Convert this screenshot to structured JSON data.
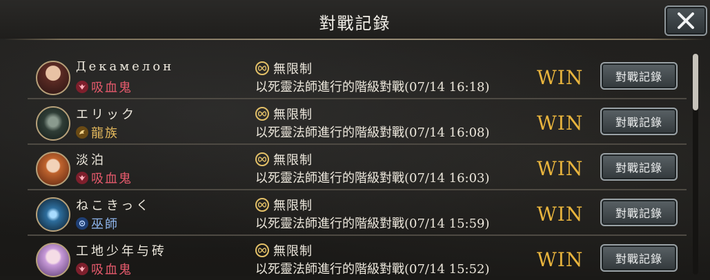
{
  "header": {
    "title": "對戰記錄"
  },
  "colors": {
    "vampire": "#e65a6c",
    "dragon": "#e3b85c",
    "mage": "#8fb6ee",
    "win": "#e8b43d"
  },
  "rows": [
    {
      "name": "Декамелон",
      "class_label": "吸血鬼",
      "class_icon": "vampire-icon",
      "mode": "無限制",
      "desc": "以死靈法師進行的階級對戰(07/14 16:18)",
      "result": "WIN",
      "button": "對戰記錄"
    },
    {
      "name": "エリック",
      "class_label": "龍族",
      "class_icon": "dragon-icon",
      "mode": "無限制",
      "desc": "以死靈法師進行的階級對戰(07/14 16:08)",
      "result": "WIN",
      "button": "對戰記錄"
    },
    {
      "name": "淡泊",
      "class_label": "吸血鬼",
      "class_icon": "vampire-icon",
      "mode": "無限制",
      "desc": "以死靈法師進行的階級對戰(07/14 16:03)",
      "result": "WIN",
      "button": "對戰記錄"
    },
    {
      "name": "ねこきっく",
      "class_label": "巫師",
      "class_icon": "mage-icon",
      "mode": "無限制",
      "desc": "以死靈法師進行的階級對戰(07/14 15:59)",
      "result": "WIN",
      "button": "對戰記錄"
    },
    {
      "name": "工地少年与砖",
      "class_label": "吸血鬼",
      "class_icon": "vampire-icon",
      "mode": "無限制",
      "desc": "以死靈法師進行的階級對戰(07/14 15:52)",
      "result": "WIN",
      "button": "對戰記錄"
    }
  ]
}
